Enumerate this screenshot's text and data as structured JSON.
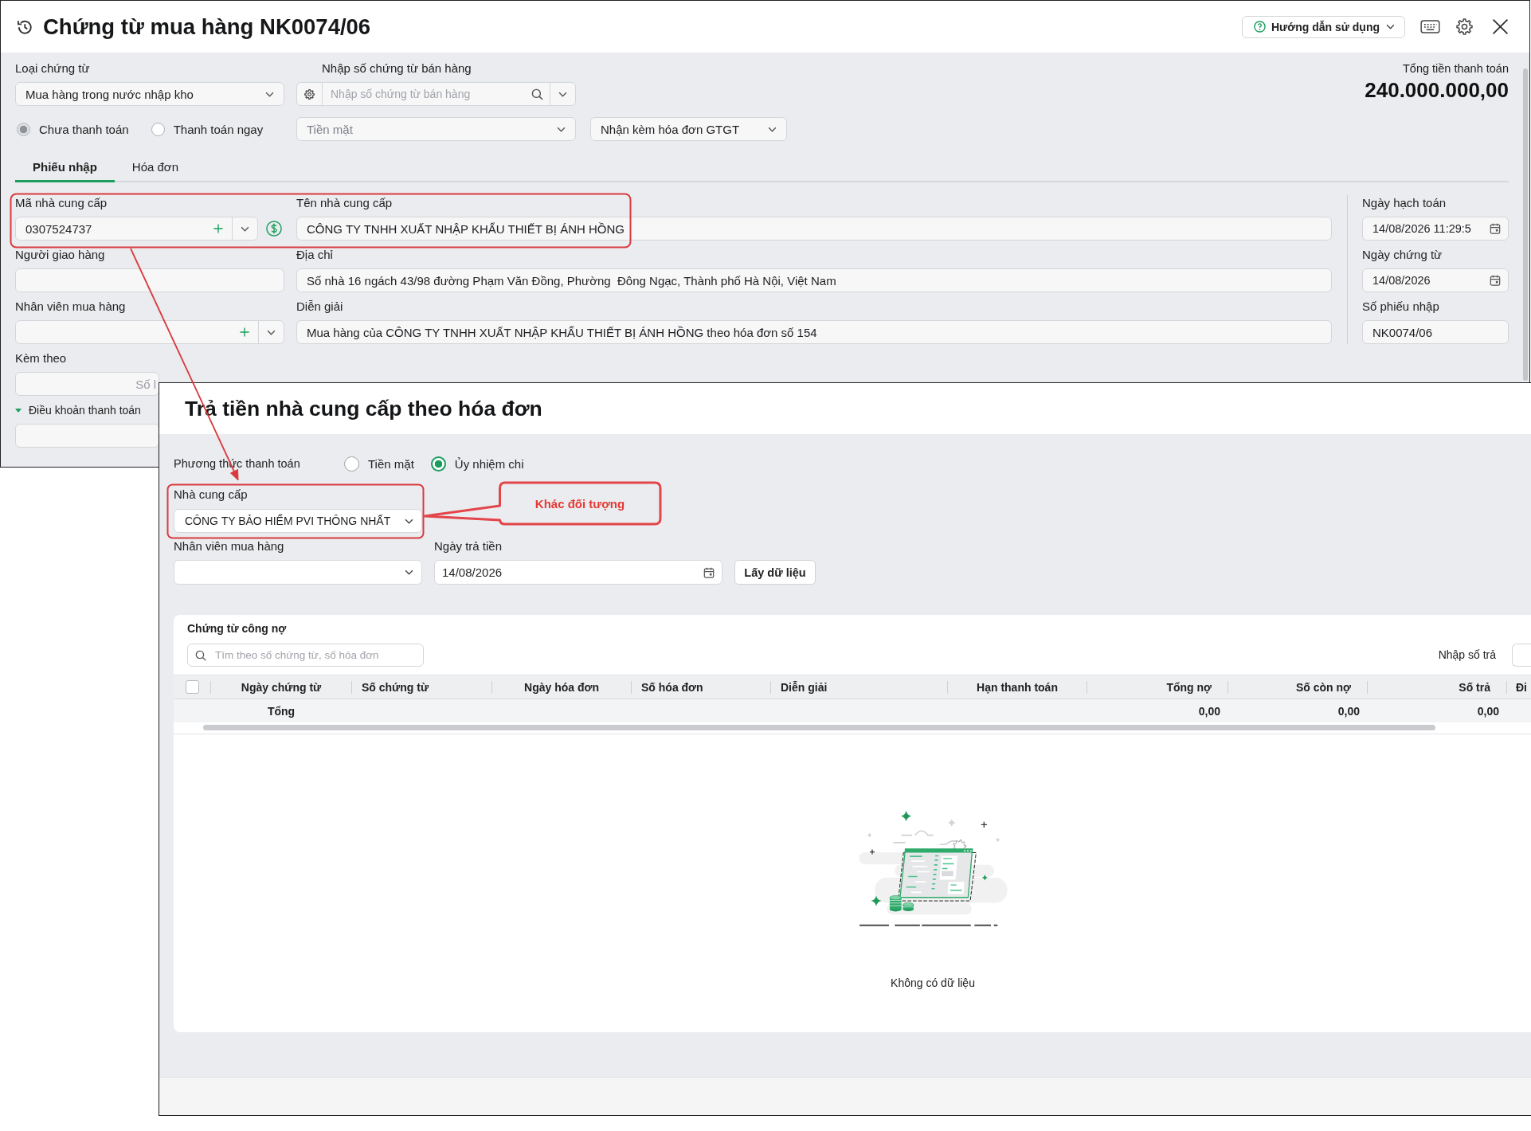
{
  "main_window": {
    "title": "Chứng từ mua hàng NK0074/06",
    "help_button": "Hướng dẫn sử dụng",
    "voucher_type": {
      "label": "Loại chứng từ",
      "value": "Mua hàng trong nước nhập kho"
    },
    "sales_voucher": {
      "label": "Nhập số chứng từ bán hàng",
      "placeholder": "Nhập số chứng từ bán hàng"
    },
    "total": {
      "label": "Tổng tiền thanh toán",
      "value": "240.000.000,00"
    },
    "payment_status": [
      {
        "label": "Chưa thanh toán",
        "selected": true
      },
      {
        "label": "Thanh toán ngay",
        "selected": false
      }
    ],
    "payment_method": {
      "value": "Tiền mặt",
      "disabled": true
    },
    "invoice_option": {
      "value": "Nhận kèm hóa đơn GTGT"
    },
    "tabs": [
      {
        "label": "Phiếu nhập",
        "selected": true
      },
      {
        "label": "Hóa đơn",
        "selected": false
      }
    ],
    "supplier_code": {
      "label": "Mã nhà cung cấp",
      "value": "0307524737"
    },
    "supplier_name": {
      "label": "Tên nhà cung cấp",
      "value": "CÔNG TY TNHH XUẤT NHẬP KHẨU THIẾT BỊ ÁNH HỒNG"
    },
    "deliverer": {
      "label": "Người giao hàng"
    },
    "address": {
      "label": "Địa chỉ",
      "value": "Số nhà 16 ngách 43/98 đường Phạm Văn Đồng, Phường  Đông Ngạc, Thành phố Hà Nội, Việt Nam"
    },
    "purchaser": {
      "label": "Nhân viên mua hàng"
    },
    "description": {
      "label": "Diễn giải",
      "value": "Mua hàng của CÔNG TY TNHH XUẤT NHẬP KHẨU THIẾT BỊ ÁNH HỒNG theo hóa đơn số 154"
    },
    "attachments": {
      "label": "Kèm theo",
      "placeholder": "Số l"
    },
    "payment_terms": {
      "label": "Điều khoản thanh toán",
      "expanded": true
    },
    "posting_date": {
      "label": "Ngày hạch toán",
      "value": "14/08/2026 11:29:5"
    },
    "voucher_date": {
      "label": "Ngày chứng từ",
      "value": "14/08/2026"
    },
    "receipt_number": {
      "label": "Số phiếu nhập",
      "value": "NK0074/06"
    }
  },
  "dialog": {
    "title": "Trả tiền nhà cung cấp theo hóa đơn",
    "payment_method": {
      "label": "Phương thức thanh toán",
      "options": [
        {
          "label": "Tiền mặt",
          "selected": false
        },
        {
          "label": "Ủy nhiệm chi",
          "selected": true
        }
      ]
    },
    "supplier": {
      "label": "Nhà cung cấp",
      "value": "CÔNG TY BẢO HIỂM PVI THÔNG NHẤT"
    },
    "purchaser": {
      "label": "Nhân viên mua hàng"
    },
    "payment_date": {
      "label": "Ngày trả tiền",
      "value": "14/08/2026"
    },
    "fetch_button": "Lấy dữ liệu",
    "debt_vouchers": {
      "title": "Chứng từ công nợ",
      "search": {
        "placeholder": "Tìm theo số chứng từ, số hóa đơn"
      },
      "pay_amount": {
        "label": "Nhập số trả"
      },
      "table": {
        "select_all": {
          "checked": false
        },
        "columns": [
          "Ngày chứng từ",
          "Số chứng từ",
          "Ngày hóa đơn",
          "Số hóa đơn",
          "Diễn giải",
          "Hạn thanh toán",
          "Tổng nợ",
          "Số còn nợ",
          "Số trả",
          "Đi"
        ],
        "total_row": {
          "label": "Tổng",
          "total_debt": "0,00",
          "remaining_debt": "0,00",
          "paid": "0,00"
        },
        "empty_text": "Không có dữ liệu"
      }
    }
  },
  "annotation": {
    "callout": "Khác đối tượng"
  }
}
